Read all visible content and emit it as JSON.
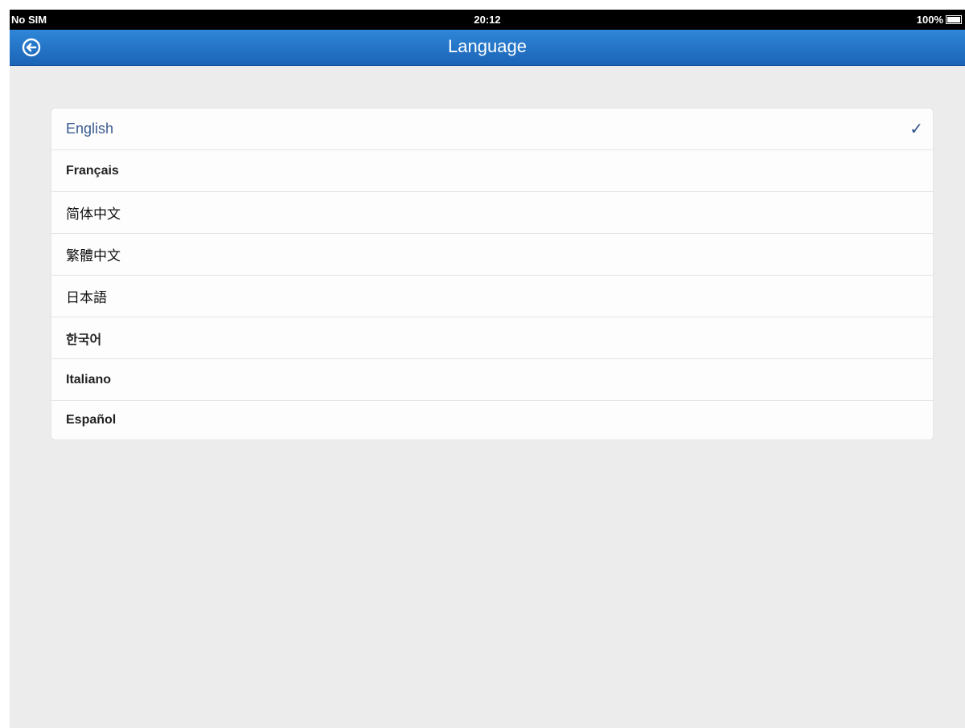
{
  "status_bar": {
    "carrier": "No SIM",
    "time": "20:12",
    "battery": "100%"
  },
  "nav": {
    "title": "Language",
    "back_icon": "back-arrow-circle-icon"
  },
  "languages": [
    {
      "label": "English",
      "selected": true,
      "style": "regular"
    },
    {
      "label": "Français",
      "selected": false,
      "style": "bold"
    },
    {
      "label": "简体中文",
      "selected": false,
      "style": "regular"
    },
    {
      "label": "繁體中文",
      "selected": false,
      "style": "regular"
    },
    {
      "label": "日本語",
      "selected": false,
      "style": "regular"
    },
    {
      "label": "한국어",
      "selected": false,
      "style": "bold"
    },
    {
      "label": "Italiano",
      "selected": false,
      "style": "bold"
    },
    {
      "label": "Español",
      "selected": false,
      "style": "bold"
    }
  ],
  "check_glyph": "✓",
  "colors": {
    "nav_top": "#2f86d8",
    "nav_bottom": "#1b64b6",
    "selected_text": "#3a5a8e",
    "background": "#ececec"
  }
}
